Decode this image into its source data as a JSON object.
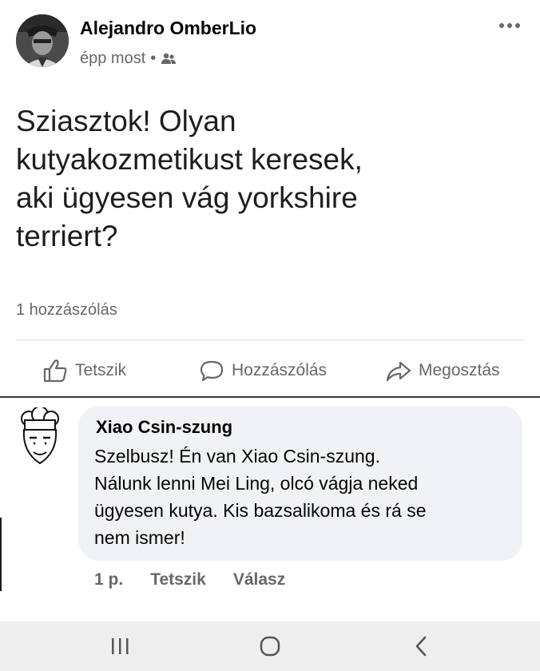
{
  "post": {
    "author": "Alejandro OmberLio",
    "timestamp": "épp most",
    "separator": "•",
    "audience_icon": "friends-icon",
    "text": "Sziasztok! Olyan\nkutyakozmetikust keresek,\naki ügyesen vág yorkshire\nterriert?",
    "comment_count": "1 hozzászólás"
  },
  "actions": {
    "like": "Tetszik",
    "comment": "Hozzászólás",
    "share": "Megosztás"
  },
  "comment": {
    "author": "Xiao Csin-szung",
    "text": "Szelbusz! Én van Xiao Csin-szung.\nNálunk lenni Mei Ling, olcó vágja neked\nügyesen kutya. Kis bazsalikoma és rá se\nnem ismer!",
    "time": "1 p.",
    "like": "Tetszik",
    "reply": "Válasz"
  },
  "navbar": {
    "icons": [
      "recent-apps-icon",
      "home-icon",
      "back-icon"
    ]
  },
  "colors": {
    "secondary_text": "#65676b",
    "bubble_bg": "#f0f2f5",
    "navbar_bg": "#eeeeee"
  }
}
